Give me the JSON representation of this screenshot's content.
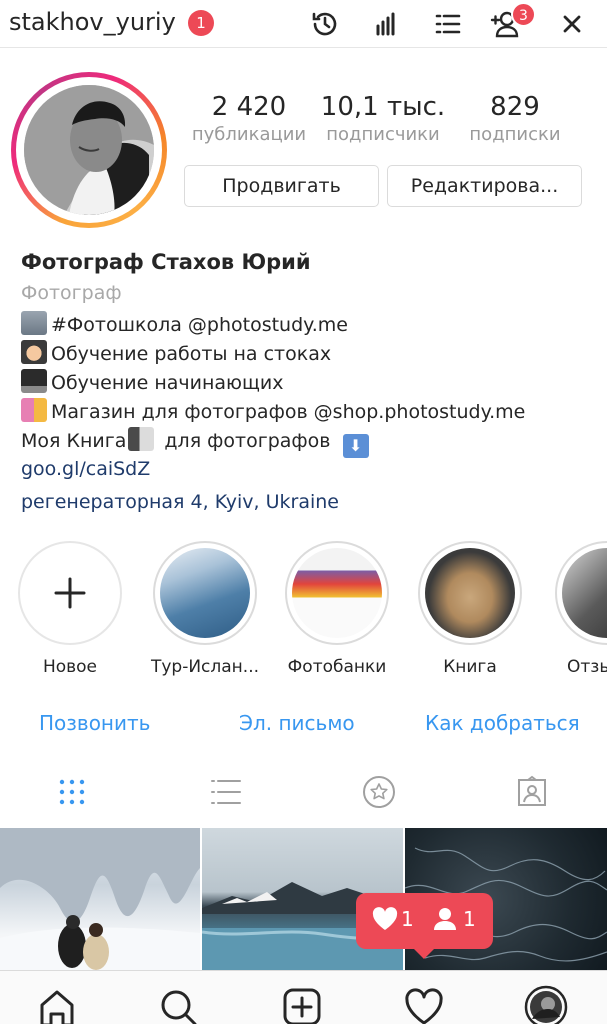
{
  "header": {
    "username": "stakhov_yuriy",
    "username_badge": "1",
    "follow_requests_badge": "3",
    "icons": [
      "archive-icon",
      "insights-icon",
      "menu-list-icon",
      "discover-people-icon",
      "more-icon"
    ]
  },
  "profile": {
    "stats": [
      {
        "value": "2 420",
        "label": "публикации"
      },
      {
        "value": "10,1 тыс.",
        "label": "подписчики"
      },
      {
        "value": "829",
        "label": "подписки"
      }
    ],
    "promote_label": "Продвигать",
    "edit_label": "Редактирова..."
  },
  "bio": {
    "name": "Фотограф Стахов Юрий",
    "category": "Фотограф",
    "lines": [
      {
        "emoji": "office-building-emoji",
        "text": "#Фотошкола @photostudy.me"
      },
      {
        "emoji": "student-emoji",
        "text": "Обучение работы на стоках"
      },
      {
        "emoji": "laptop-emoji",
        "text": "Обучение начинающих"
      },
      {
        "emoji": "shopping-bags-emoji",
        "text": "Магазин для фотографов @shop.photostudy.me"
      }
    ],
    "book_prefix": "Моя Книга",
    "book_suffix": " для фотографов",
    "link": "goo.gl/caiSdZ",
    "location": "регенераторная 4, Kyiv, Ukraine"
  },
  "highlights": [
    {
      "label": "Новое"
    },
    {
      "label": "Тур-Ислан..."
    },
    {
      "label": "Фотобанки"
    },
    {
      "label": "Книга"
    },
    {
      "label": "Отзы"
    }
  ],
  "contact": {
    "call": "Позвонить",
    "email": "Эл. письмо",
    "directions": "Как добраться"
  },
  "activity": {
    "likes": "1",
    "follows": "1"
  },
  "colors": {
    "accent_blue": "#3897f0",
    "badge_red": "#ed4956",
    "link_navy": "#1f3b6b"
  }
}
